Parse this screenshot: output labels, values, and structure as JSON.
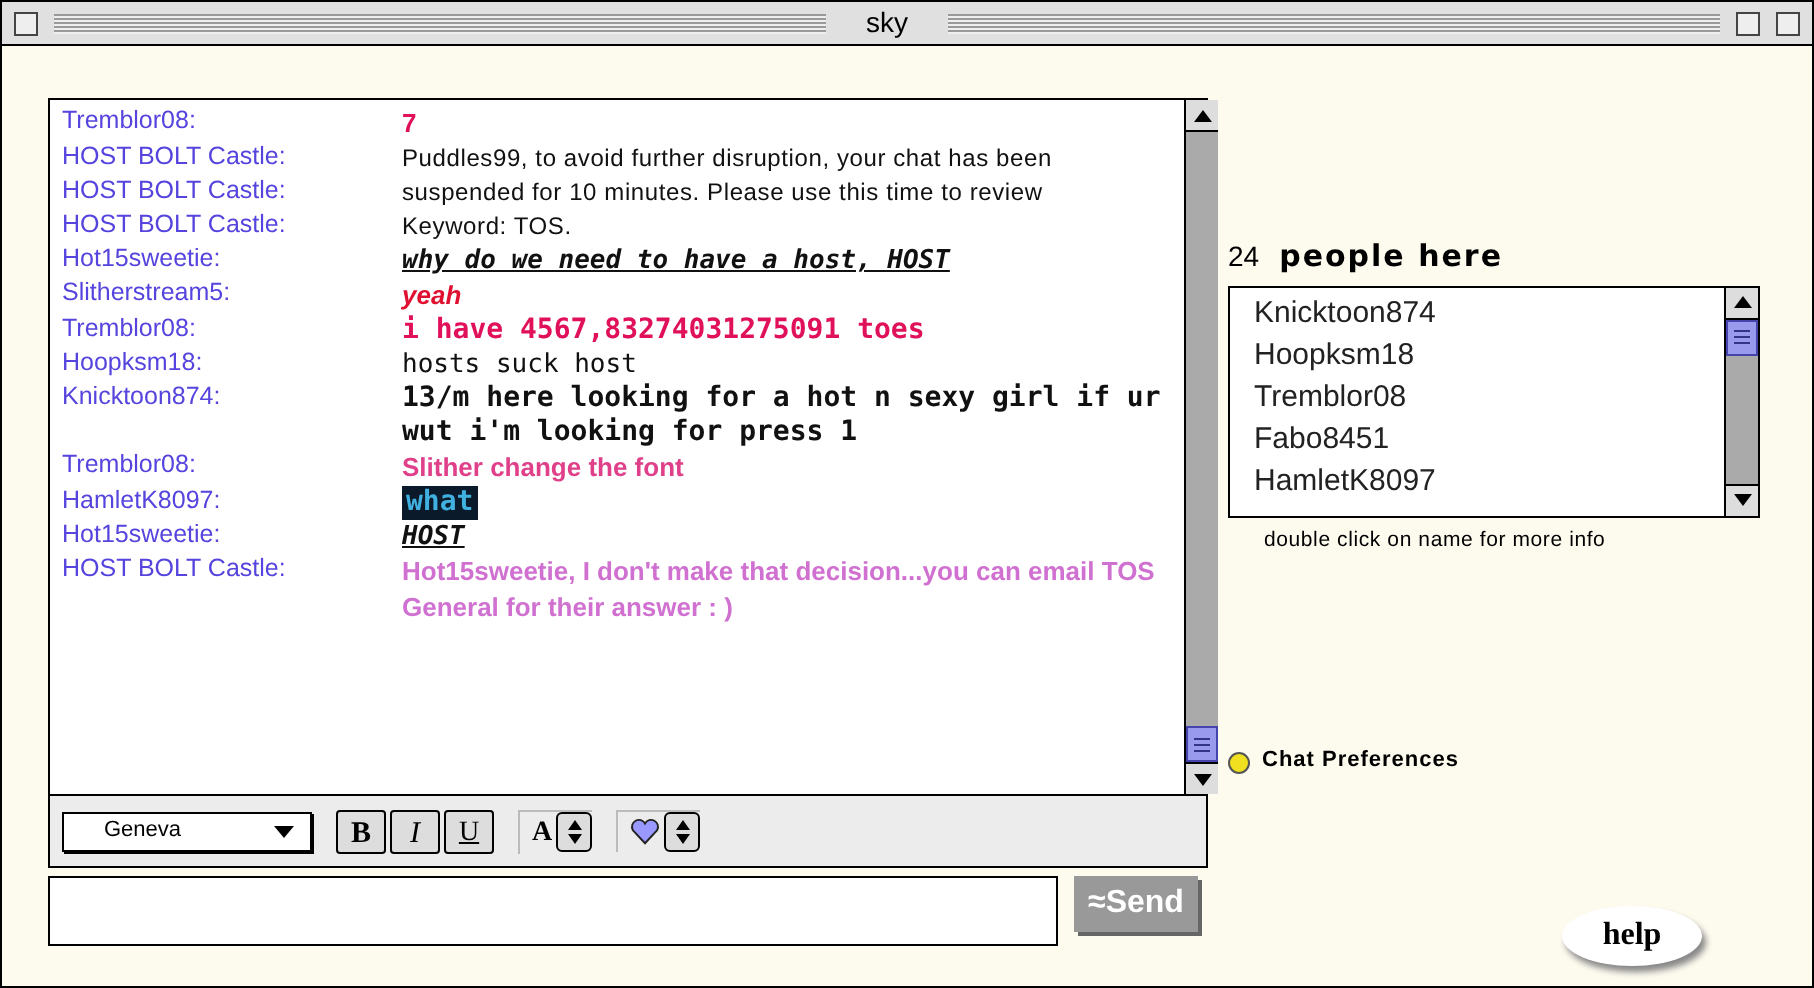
{
  "window": {
    "title": "sky"
  },
  "messages": [
    {
      "name": "Tremblor08:",
      "text": "7",
      "kind": "bold",
      "color": "#e0105a"
    },
    {
      "name": "HOST BOLT Castle:",
      "text": "Puddles99, to avoid further disruption, your chat has been",
      "kind": "plain",
      "color": "#111111"
    },
    {
      "name": "HOST BOLT Castle:",
      "text": "suspended for 10 minutes. Please use this time to review",
      "kind": "plain",
      "color": "#111111"
    },
    {
      "name": "HOST BOLT Castle:",
      "text": "Keyword: TOS.",
      "kind": "plain",
      "color": "#111111"
    },
    {
      "name": "Hot15sweetie:",
      "text": "why do we need to have a host, HOST",
      "kind": "italic-underline",
      "color": "#111111"
    },
    {
      "name": "Slitherstream5:",
      "text": "yeah",
      "kind": "italic",
      "color": "#e01030"
    },
    {
      "name": "Tremblor08:",
      "text": "i have 4567,83274031275091 toes",
      "kind": "mono-bold",
      "color": "#e0105a"
    },
    {
      "name": "Hoopksm18:",
      "text": "hosts suck host",
      "kind": "mono",
      "color": "#111111"
    },
    {
      "name": "Knicktoon874:",
      "text": "13/m here looking for a hot n sexy girl if ur wut i'm looking for press 1",
      "kind": "mono-bold",
      "color": "#111111"
    },
    {
      "name": "Tremblor08:",
      "text": "Slither change the font",
      "kind": "bold",
      "color": "#e0408a"
    },
    {
      "name": "HamletK8097:",
      "text": "what",
      "kind": "highlight",
      "color": "#3fb0e0"
    },
    {
      "name": "Hot15sweetie:",
      "text": "HOST",
      "kind": "italic-underline",
      "color": "#111111"
    },
    {
      "name": "HOST BOLT Castle:",
      "text": "Hot15sweetie, I don't make that decision...you can email TOS General for their answer : )",
      "kind": "bold",
      "color": "#d070d0"
    }
  ],
  "toolbar": {
    "font": "Geneva",
    "bold": "B",
    "italic": "I",
    "underline": "U",
    "size": "A"
  },
  "input": {
    "send": "≈Send"
  },
  "people": {
    "count": "24",
    "label": "people here",
    "names": [
      "Knicktoon874",
      "Hoopksm18",
      "Tremblor08",
      "Fabo8451",
      "HamletK8097"
    ],
    "hint": "double click on name for more info"
  },
  "preferences": "Chat Preferences",
  "help": "help"
}
